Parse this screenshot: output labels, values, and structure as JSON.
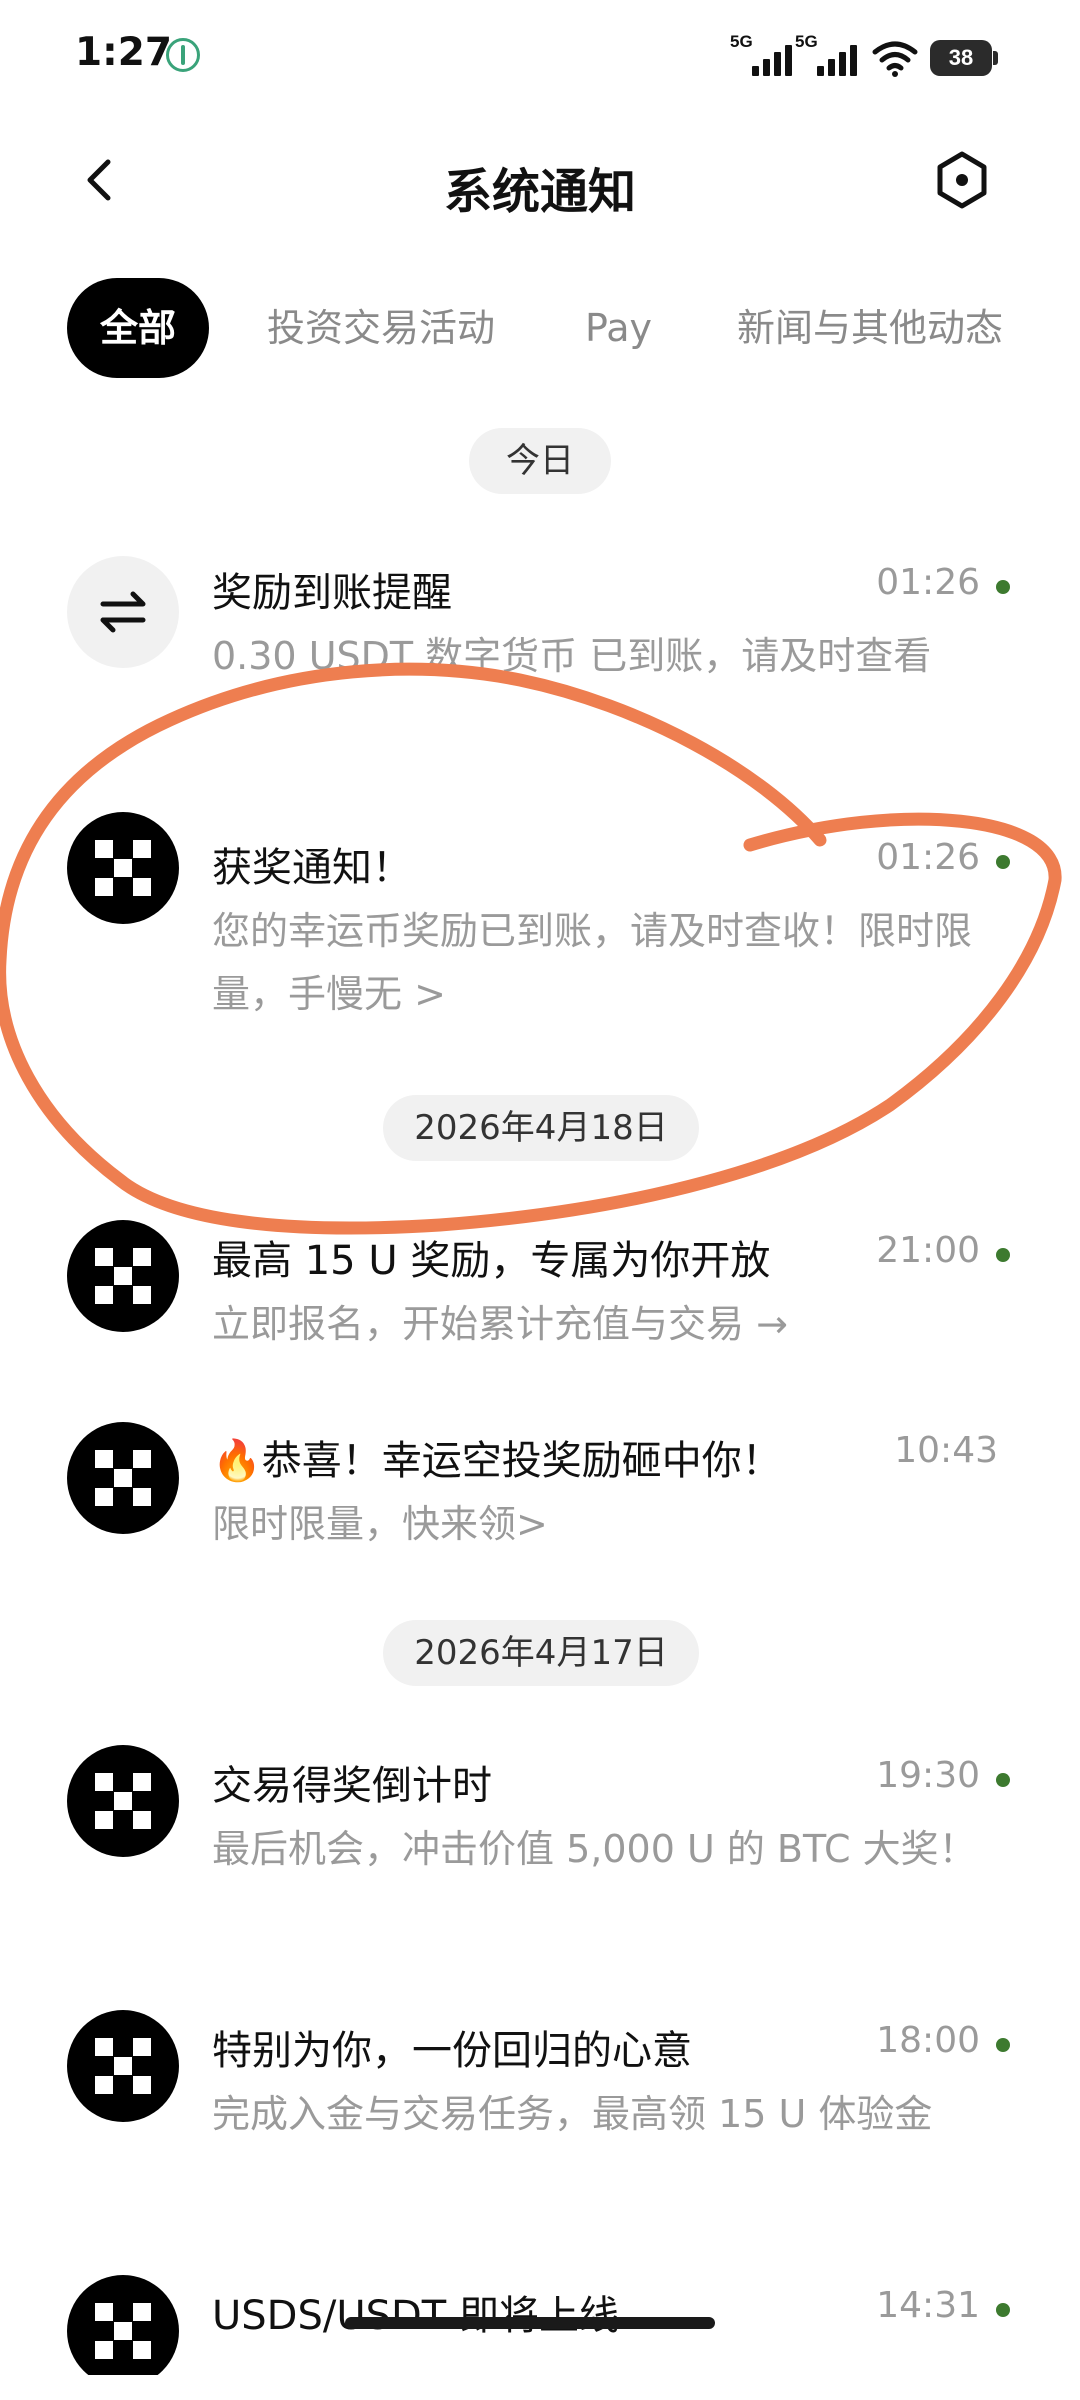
{
  "status_bar": {
    "time": "1:27",
    "signal_1": "5G",
    "signal_2": "5G",
    "battery": "38"
  },
  "header": {
    "title": "系统通知"
  },
  "tabs": [
    {
      "label": "全部",
      "active": true
    },
    {
      "label": "投资交易活动",
      "active": false
    },
    {
      "label": "Pay",
      "active": false
    },
    {
      "label": "新闻与其他动态",
      "active": false
    }
  ],
  "sections": [
    {
      "date": "今日",
      "items": [
        {
          "icon": "swap-arrows-icon",
          "title": "奖励到账提醒",
          "time": "01:26",
          "unread": true,
          "body": "0.30 USDT 数字货币 已到账，请及时查看"
        },
        {
          "icon": "okx-logo-icon",
          "title": "获奖通知！",
          "time": "01:26",
          "unread": true,
          "body": "您的幸运币奖励已到账，请及时查收！限时限量，手慢无 >"
        }
      ]
    },
    {
      "date": "2026年4月18日",
      "items": [
        {
          "icon": "okx-logo-icon",
          "title": "最高 15 U 奖励，专属为你开放",
          "time": "21:00",
          "unread": true,
          "body": "立即报名，开始累计充值与交易 →"
        },
        {
          "icon": "okx-logo-icon",
          "title": "🔥恭喜！幸运空投奖励砸中你！",
          "time": "10:43",
          "unread": false,
          "body": "限时限量，快来领>"
        }
      ]
    },
    {
      "date": "2026年4月17日",
      "items": [
        {
          "icon": "okx-logo-icon",
          "title": "交易得奖倒计时",
          "time": "19:30",
          "unread": true,
          "body": "最后机会，冲击价值 5,000 U 的 BTC 大奖！"
        },
        {
          "icon": "okx-logo-icon",
          "title": "特别为你，一份回归的心意",
          "time": "18:00",
          "unread": true,
          "body": "完成入金与交易任务，最高领 15 U 体验金"
        },
        {
          "icon": "okx-logo-icon",
          "title": "USDS/USDT 即将上线",
          "time": "14:31",
          "unread": true,
          "body": ""
        }
      ]
    }
  ],
  "colors": {
    "unread_dot": "#3d7a2f",
    "annotation": "#ee7e50",
    "active_tab_bg": "#000000"
  }
}
